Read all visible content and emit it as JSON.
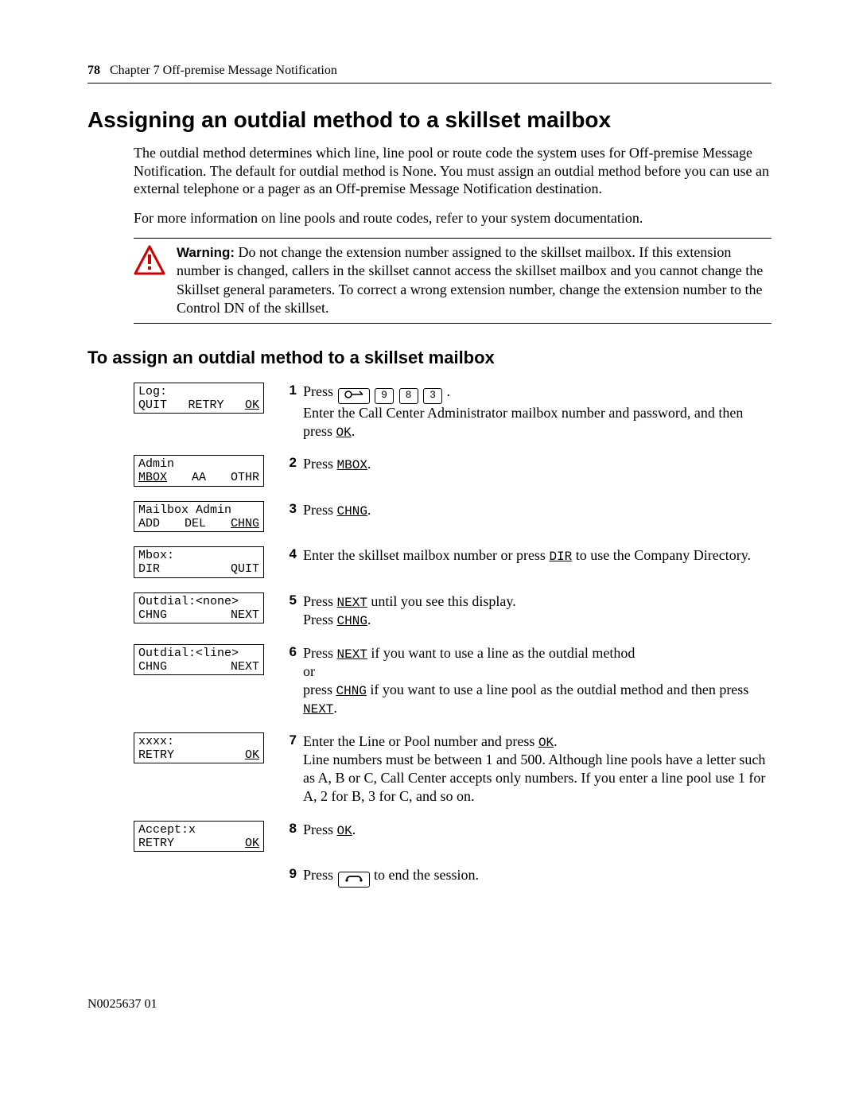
{
  "header": {
    "page_number": "78",
    "chapter": "Chapter 7  Off-premise Message Notification"
  },
  "section_title": "Assigning an outdial method to a skillset mailbox",
  "para1": "The outdial method determines which line, line pool or route code the system uses for Off-premise Message Notification. The default for outdial method is None. You must assign an outdial method before you can use an external telephone or a pager as an Off-premise Message Notification destination.",
  "para2": "For more information on line pools and route codes, refer to your system documentation.",
  "warning": {
    "label": "Warning:",
    "text": " Do not change the extension number assigned to the skillset mailbox. If this extension number is changed, callers in the skillset cannot access the skillset mailbox and you cannot change the Skillset general parameters. To correct a wrong extension number, change the extension number to the Control DN of the skillset."
  },
  "subsection_title": "To assign an outdial method to a skillset mailbox",
  "lcd": {
    "s1": {
      "line1": "Log:",
      "k1": "QUIT",
      "k2": "RETRY",
      "k3": "OK",
      "k3u": true
    },
    "s2": {
      "line1": "Admin",
      "k1": "MBOX",
      "k1u": true,
      "k2": "AA",
      "k3": "OTHR"
    },
    "s3": {
      "line1": "Mailbox Admin",
      "k1": "ADD",
      "k2": "DEL",
      "k3": "CHNG",
      "k3u": true
    },
    "s4": {
      "line1": "Mbox:",
      "k1": "DIR",
      "k2": "",
      "k3": "QUIT"
    },
    "s5": {
      "line1": "Outdial:<none>",
      "k1": "CHNG",
      "k2": "",
      "k3": "NEXT"
    },
    "s6": {
      "line1": "Outdial:<line>",
      "k1": "CHNG",
      "k2": "",
      "k3": "NEXT"
    },
    "s7": {
      "line1": "xxxx:",
      "k1": "RETRY",
      "k2": "",
      "k3": "OK",
      "k3u": true
    },
    "s8": {
      "line1": "Accept:x",
      "k1": "RETRY",
      "k2": "",
      "k3": "OK",
      "k3u": true
    }
  },
  "steps": {
    "s1n": "1",
    "s2n": "2",
    "s3n": "3",
    "s4n": "4",
    "s5n": "5",
    "s6n": "6",
    "s7n": "7",
    "s8n": "8",
    "s9n": "9",
    "s1": {
      "pre": "Press ",
      "keys": [
        "9",
        "8",
        "3"
      ],
      "post": ".",
      "line2a": "Enter the Call Center Administrator mailbox number and password, and then press ",
      "line2k": "OK",
      "line2b": "."
    },
    "s2": {
      "a": "Press ",
      "k": "MBOX",
      "b": "."
    },
    "s3": {
      "a": "Press ",
      "k": "CHNG",
      "b": "."
    },
    "s4": {
      "a": "Enter the skillset mailbox number or press ",
      "k": "DIR",
      "b": " to use the Company Directory."
    },
    "s5": {
      "a": "Press ",
      "k1": "NEXT",
      "b": " until you see this display.",
      "c": "Press ",
      "k2": "CHNG",
      "d": "."
    },
    "s6": {
      "a": "Press ",
      "k1": "NEXT",
      "b": " if you want to use a line as the outdial method",
      "or": "or",
      "c": "press ",
      "k2": "CHNG",
      "d": " if you want to use a line pool as the outdial method and then press ",
      "k3": "NEXT",
      "e": "."
    },
    "s7": {
      "a": "Enter the Line or Pool number and press ",
      "k": "OK",
      "b": ".",
      "c": "Line numbers must be between 1 and 500. Although line pools have a letter such as A, B or C, Call Center accepts only numbers. If you enter a line pool use 1 for A, 2 for B, 3 for C, and so on."
    },
    "s8": {
      "a": "Press ",
      "k": "OK",
      "b": "."
    },
    "s9": {
      "a": "Press ",
      "b": " to end the session."
    }
  },
  "footer": "N0025637 01"
}
